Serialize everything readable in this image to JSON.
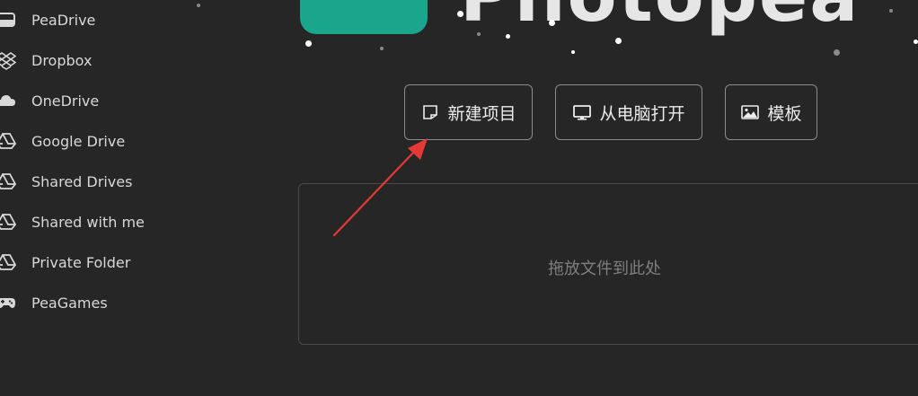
{
  "sidebar": {
    "items": [
      {
        "label": "PeaDrive",
        "icon": "drive-icon"
      },
      {
        "label": "Dropbox",
        "icon": "dropbox-icon"
      },
      {
        "label": "OneDrive",
        "icon": "cloud-icon"
      },
      {
        "label": "Google Drive",
        "icon": "google-drive-icon"
      },
      {
        "label": "Shared Drives",
        "icon": "google-drive-icon"
      },
      {
        "label": "Shared with me",
        "icon": "google-drive-icon"
      },
      {
        "label": "Private Folder",
        "icon": "google-drive-icon"
      },
      {
        "label": "PeaGames",
        "icon": "gamepad-icon"
      }
    ]
  },
  "logo": {
    "text": "Photopea",
    "accent_color": "#1aa68c"
  },
  "actions": [
    {
      "label": "新建项目",
      "icon": "new-file-icon"
    },
    {
      "label": "从电脑打开",
      "icon": "monitor-icon"
    },
    {
      "label": "模板",
      "icon": "image-icon"
    }
  ],
  "dropzone": {
    "text": "拖放文件到此处"
  },
  "annotation": {
    "arrow_color": "#e53935"
  }
}
